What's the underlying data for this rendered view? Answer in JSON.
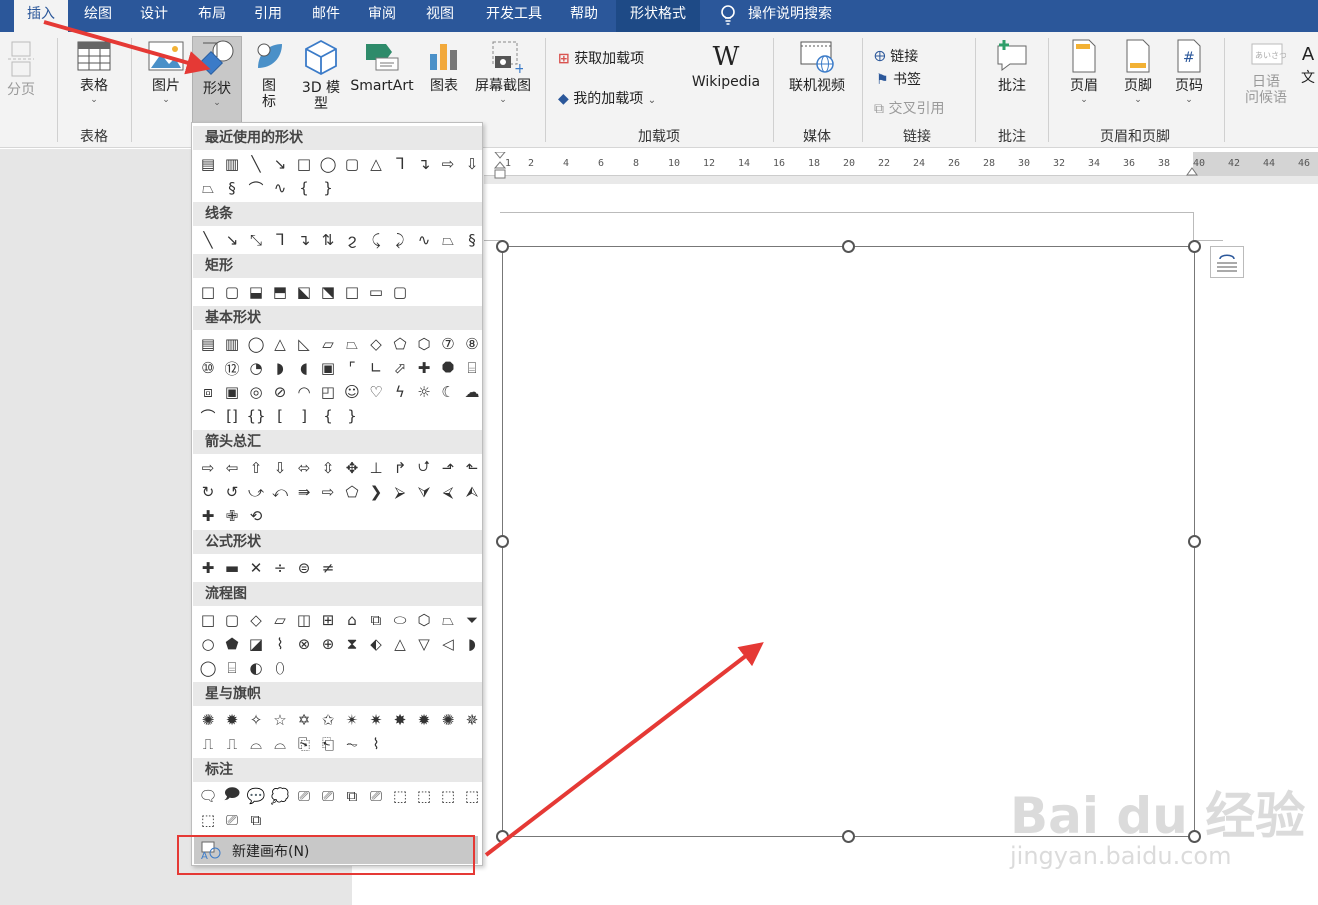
{
  "tabs": [
    "插入",
    "绘图",
    "设计",
    "布局",
    "引用",
    "邮件",
    "审阅",
    "视图",
    "开发工具",
    "帮助",
    "形状格式"
  ],
  "tell_me": "操作说明搜索",
  "ribbon": {
    "page_break": "分页",
    "table": "表格",
    "picture": "图片",
    "shapes": "形状",
    "icons_line1": "图",
    "icons_line2": "标",
    "model3d_line1": "3D 模",
    "model3d_line2": "型",
    "smartart": "SmartArt",
    "chart": "图表",
    "screenshot": "屏幕截图",
    "get_addins": "获取加载项",
    "my_addins": "我的加载项",
    "wikipedia": "Wikipedia",
    "online_video": "联机视频",
    "link": "链接",
    "bookmark": "书签",
    "cross_ref": "交叉引用",
    "comment": "批注",
    "header": "页眉",
    "footer": "页脚",
    "page_number": "页码",
    "japanese_line1": "日语",
    "japanese_line2": "问候语",
    "text_partial": "文"
  },
  "groups": {
    "tables": "表格",
    "addins": "加载项",
    "media": "媒体",
    "links": "链接",
    "comments": "批注",
    "header_footer": "页眉和页脚"
  },
  "ruler_ticks": [
    "1",
    "2",
    "4",
    "6",
    "8",
    "10",
    "12",
    "14",
    "16",
    "18",
    "20",
    "22",
    "24",
    "26",
    "28",
    "30",
    "32",
    "34",
    "36",
    "38",
    "40",
    "42",
    "44",
    "46"
  ],
  "shapes_menu": {
    "recent": "最近使用的形状",
    "lines": "线条",
    "rectangles": "矩形",
    "basic": "基本形状",
    "arrows": "箭头总汇",
    "equation": "公式形状",
    "flowchart": "流程图",
    "stars": "星与旗帜",
    "callouts": "标注",
    "new_canvas": "新建画布(N)"
  },
  "watermark": {
    "brand": "Bai du 经验",
    "url": "jingyan.baidu.com"
  },
  "colors": {
    "tab_bar": "#2b579a",
    "annotation_red": "#e53935"
  }
}
